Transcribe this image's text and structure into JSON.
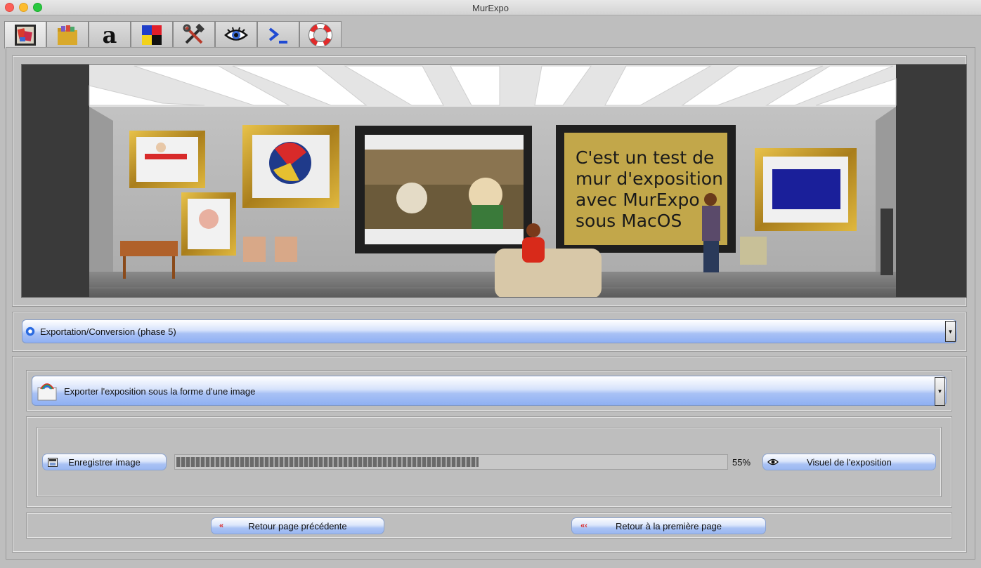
{
  "window": {
    "title": "MurExpo"
  },
  "tabs": [
    {
      "icon": "exposition-icon"
    },
    {
      "icon": "folder-icon"
    },
    {
      "icon": "font-icon"
    },
    {
      "icon": "color-palette-icon"
    },
    {
      "icon": "tools-icon"
    },
    {
      "icon": "eye-icon"
    },
    {
      "icon": "terminal-icon"
    },
    {
      "icon": "lifebuoy-icon"
    }
  ],
  "banner": {
    "wall_text_lines": [
      "C'est un test de",
      "mur d'exposition",
      "avec MurExpo",
      "sous MacOS"
    ]
  },
  "phase_select": {
    "value": "Exportation/Conversion (phase 5)"
  },
  "action_select": {
    "value": "Exporter l'exposition sous la forme d'une image"
  },
  "export": {
    "save_label": "Enregistrer image",
    "progress": 0.55,
    "progress_text": "55%",
    "view_label": "Visuel de l'exposition"
  },
  "nav": {
    "back_label": "Retour page précédente",
    "first_label": "Retour à la première page"
  },
  "colors": {
    "accent_blue": "#9bb8f2",
    "panel": "#bebebe",
    "wall_frame_gold": "#c9a227",
    "wall_text_bg": "#c4a84a"
  }
}
